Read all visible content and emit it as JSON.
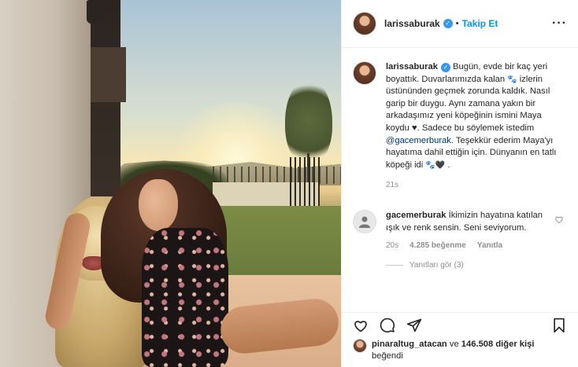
{
  "post": {
    "author": "larissaburak",
    "follow_label": "Takip Et",
    "separator": "•",
    "more_icon": "more-horizontal-icon"
  },
  "caption": {
    "username": "larissaburak",
    "line1": "Bugün, evde bir kaç yeri boyattık. Duvarlarımızda kalan",
    "line2": "izlerin üstününden geçmek zorunda kaldık. Nasıl garip bir duygu. Aynı zamana yakın bir arkadaşımız yeni köpeğinin ismini Maya koydu",
    "heart": "♥",
    "line3": ". Sadece bu söylemek istedim",
    "mention": "@gacemerburak",
    "line4": ". Teşekkür ederim Maya'yı hayatıma dahil ettiğin için. Dünyanın en tatlı köpeği idi",
    "paw_emoji": "🐾",
    "black_heart": "🖤",
    "end": ".",
    "time": "21s"
  },
  "comment": {
    "username": "gacemerburak",
    "text": "İkimizin hayatına katılan ışık ve renk sensin. Seni seviyorum.",
    "time": "20s",
    "likes": "4.285 beğenme",
    "reply": "Yanıtla",
    "hidden_text": "Yanıtları gör (3)"
  },
  "likes": {
    "liker": "pinaraltug_atacan",
    "connector": "ve",
    "count": "146.508 diğer kişi",
    "suffix": "beğendi"
  },
  "icons": {
    "like": "heart-icon",
    "comment": "comment-icon",
    "share": "share-icon",
    "save": "bookmark-icon"
  }
}
